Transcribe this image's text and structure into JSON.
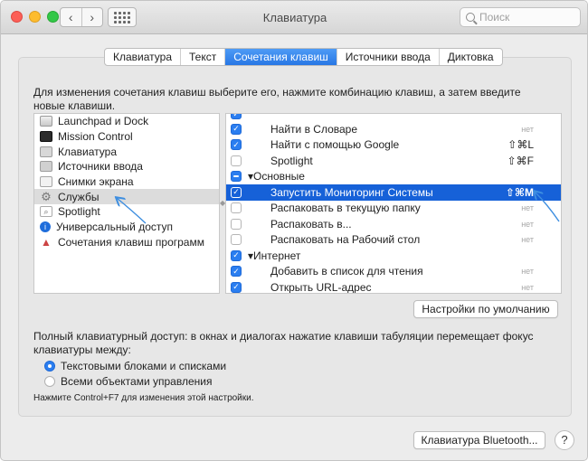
{
  "window": {
    "title": "Клавиатура",
    "back_glyph": "‹",
    "forward_glyph": "›"
  },
  "search": {
    "placeholder": "Поиск"
  },
  "tabs": [
    {
      "label": "Клавиатура"
    },
    {
      "label": "Текст"
    },
    {
      "label": "Сочетания клавиш",
      "active": true
    },
    {
      "label": "Источники ввода"
    },
    {
      "label": "Диктовка"
    }
  ],
  "description": "Для изменения сочетания клавиш выберите его, нажмите комбинацию клавиш, а затем введите новые клавиши.",
  "categories": [
    {
      "label": "Launchpad и Dock",
      "icon": "launchpad-icon"
    },
    {
      "label": "Mission Control",
      "icon": "mission-control-icon"
    },
    {
      "label": "Клавиатура",
      "icon": "keyboard-icon"
    },
    {
      "label": "Источники ввода",
      "icon": "input-sources-icon"
    },
    {
      "label": "Снимки экрана",
      "icon": "screenshot-icon"
    },
    {
      "label": "Службы",
      "icon": "gear-icon",
      "selected": true
    },
    {
      "label": "Spotlight",
      "icon": "spotlight-icon"
    },
    {
      "label": "Универсальный доступ",
      "icon": "accessibility-icon"
    },
    {
      "label": "Сочетания клавиш программ",
      "icon": "app-shortcuts-icon"
    }
  ],
  "services": [
    {
      "label": "Найти в Словаре",
      "shortcut": "нет"
    },
    {
      "label": "Найти с помощью Google",
      "shortcut": "⇧⌘L"
    },
    {
      "label": "Spotlight",
      "shortcut": "⇧⌘F"
    },
    {
      "label": "Основные"
    },
    {
      "label": "Запустить Мониторинг Системы",
      "shortcut": "⇧⌘M"
    },
    {
      "label": "Распаковать в текущую папку",
      "shortcut": "нет"
    },
    {
      "label": "Распаковать в...",
      "shortcut": "нет"
    },
    {
      "label": "Распаковать на Рабочий стол",
      "shortcut": "нет"
    },
    {
      "label": "Интернет"
    },
    {
      "label": "Добавить в список для чтения",
      "shortcut": "нет"
    },
    {
      "label": "Открыть URL-адрес",
      "shortcut": "нет"
    }
  ],
  "buttons": {
    "defaults": "Настройки по умолчанию",
    "bluetooth": "Клавиатура Bluetooth...",
    "help": "?"
  },
  "keyboard_access": {
    "text": "Полный клавиатурный доступ: в окнах и диалогах нажатие клавиши табуляции перемещает фокус клавиатуры между:",
    "options": [
      {
        "label": "Текстовыми блоками и списками",
        "selected": true
      },
      {
        "label": "Всеми объектами управления",
        "selected": false
      }
    ],
    "hint": "Нажмите Control+F7 для изменения этой настройки."
  },
  "colors": {
    "accent": "#1661d8",
    "annotation": "#3d8ee0"
  }
}
